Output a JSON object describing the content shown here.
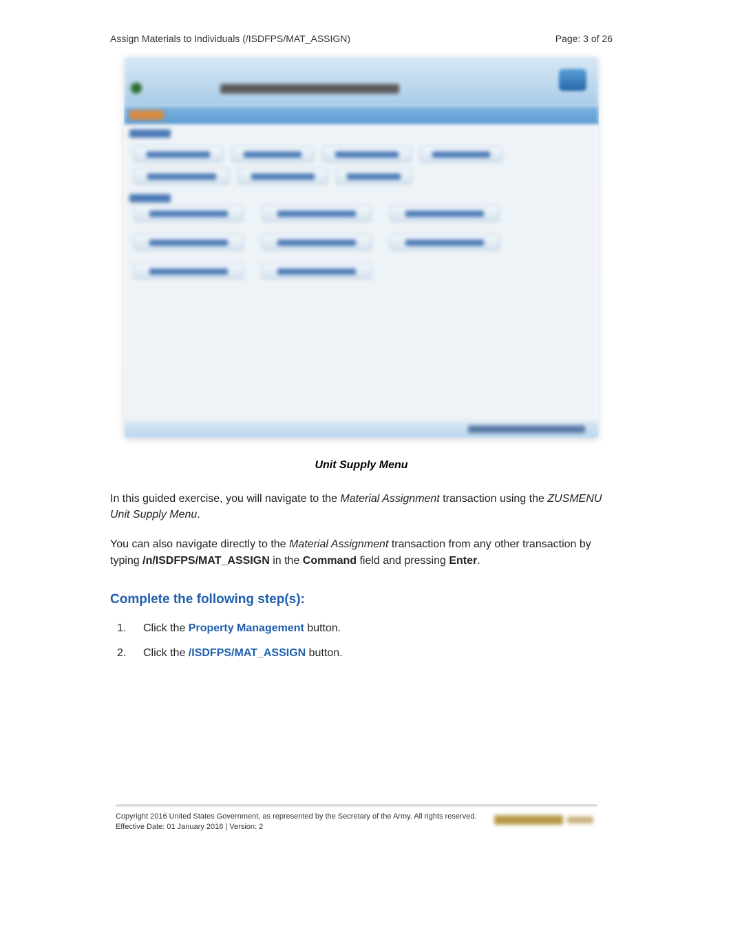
{
  "header": {
    "title": "Assign Materials to Individuals (/ISDFPS/MAT_ASSIGN)",
    "page_label": "Page: 3 of 26"
  },
  "caption": "Unit Supply Menu",
  "para1": {
    "pre": "In this guided exercise, you will navigate to the ",
    "italic1": "Material Assignment",
    "mid": " transaction using the ",
    "italic2": "ZUSMENU Unit Supply Menu",
    "post": "."
  },
  "para2": {
    "pre": "You can also navigate directly to the ",
    "italic1": "Material Assignment",
    "mid1": " transaction from any other transaction by typing ",
    "bold1": "/n/ISDFPS/MAT_ASSIGN",
    "mid2": " in the ",
    "bold2": "Command",
    "mid3": " field and pressing ",
    "bold3": "Enter",
    "post": "."
  },
  "section_title": "Complete the following step(s):",
  "steps": [
    {
      "num": "1.",
      "pre": "Click the ",
      "link": "Property Management",
      "post": " button."
    },
    {
      "num": "2.",
      "pre": "Click the ",
      "link": "/ISDFPS/MAT_ASSIGN",
      "post": " button."
    }
  ],
  "footer": {
    "line1": "Copyright 2016 United States Government, as represented by the Secretary of the Army.   All rights reserved.",
    "line2": "Effective Date:  01 January 2016 | Version: 2"
  }
}
